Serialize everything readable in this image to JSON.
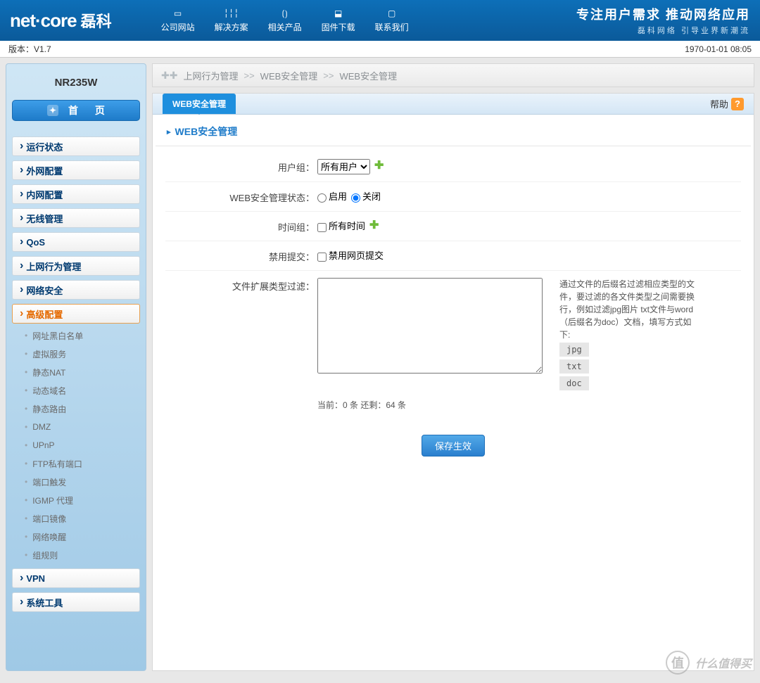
{
  "header": {
    "logo_main": "net·core",
    "logo_cn": "磊科",
    "nav": [
      {
        "label": "公司网站"
      },
      {
        "label": "解决方案"
      },
      {
        "label": "相关产品"
      },
      {
        "label": "固件下载"
      },
      {
        "label": "联系我们"
      }
    ],
    "tagline1": "专注用户需求  推动网络应用",
    "tagline2": "磊科网络 引导业界新潮流"
  },
  "subbar": {
    "version": "版本：V1.7",
    "datetime": "1970-01-01 08:05"
  },
  "sidebar": {
    "model": "NR235W",
    "home": "首 页",
    "items": [
      "运行状态",
      "外网配置",
      "内网配置",
      "无线管理",
      "QoS",
      "上网行为管理",
      "网络安全"
    ],
    "active": "高级配置",
    "subitems": [
      "网址黑白名单",
      "虚拟服务",
      "静态NAT",
      "动态域名",
      "静态路由",
      "DMZ",
      "UPnP",
      "FTP私有端口",
      "端口触发",
      "IGMP 代理",
      "端口镜像",
      "网络唤醒",
      "组规则"
    ],
    "items2": [
      "VPN",
      "系统工具"
    ]
  },
  "crumb": {
    "a": "上网行为管理",
    "b": "WEB安全管理",
    "c": "WEB安全管理",
    "sep": ">>"
  },
  "tab": {
    "label": "WEB安全管理",
    "help": "帮助"
  },
  "section": {
    "title": "WEB安全管理"
  },
  "form": {
    "usergroup_lbl": "用户组：",
    "usergroup_opts": [
      "所有用户"
    ],
    "status_lbl": "WEB安全管理状态：",
    "status_on": "启用",
    "status_off": "关闭",
    "timegroup_lbl": "时间组：",
    "timegroup_cb": "所有时间",
    "disable_lbl": "禁用提交：",
    "disable_cb": "禁用网页提交",
    "filter_lbl": "文件扩展类型过滤：",
    "counter": "当前：0 条   还剩：64 条",
    "hint_text": "通过文件的后缀名过滤相应类型的文件，要过滤的各文件类型之间需要换行，例如过滤jpg图片 txt文件与word（后缀名为doc）文档，填写方式如下:",
    "hint_tags": [
      "jpg",
      "txt",
      "doc"
    ],
    "save": "保存生效"
  },
  "watermark": "什么值得买"
}
